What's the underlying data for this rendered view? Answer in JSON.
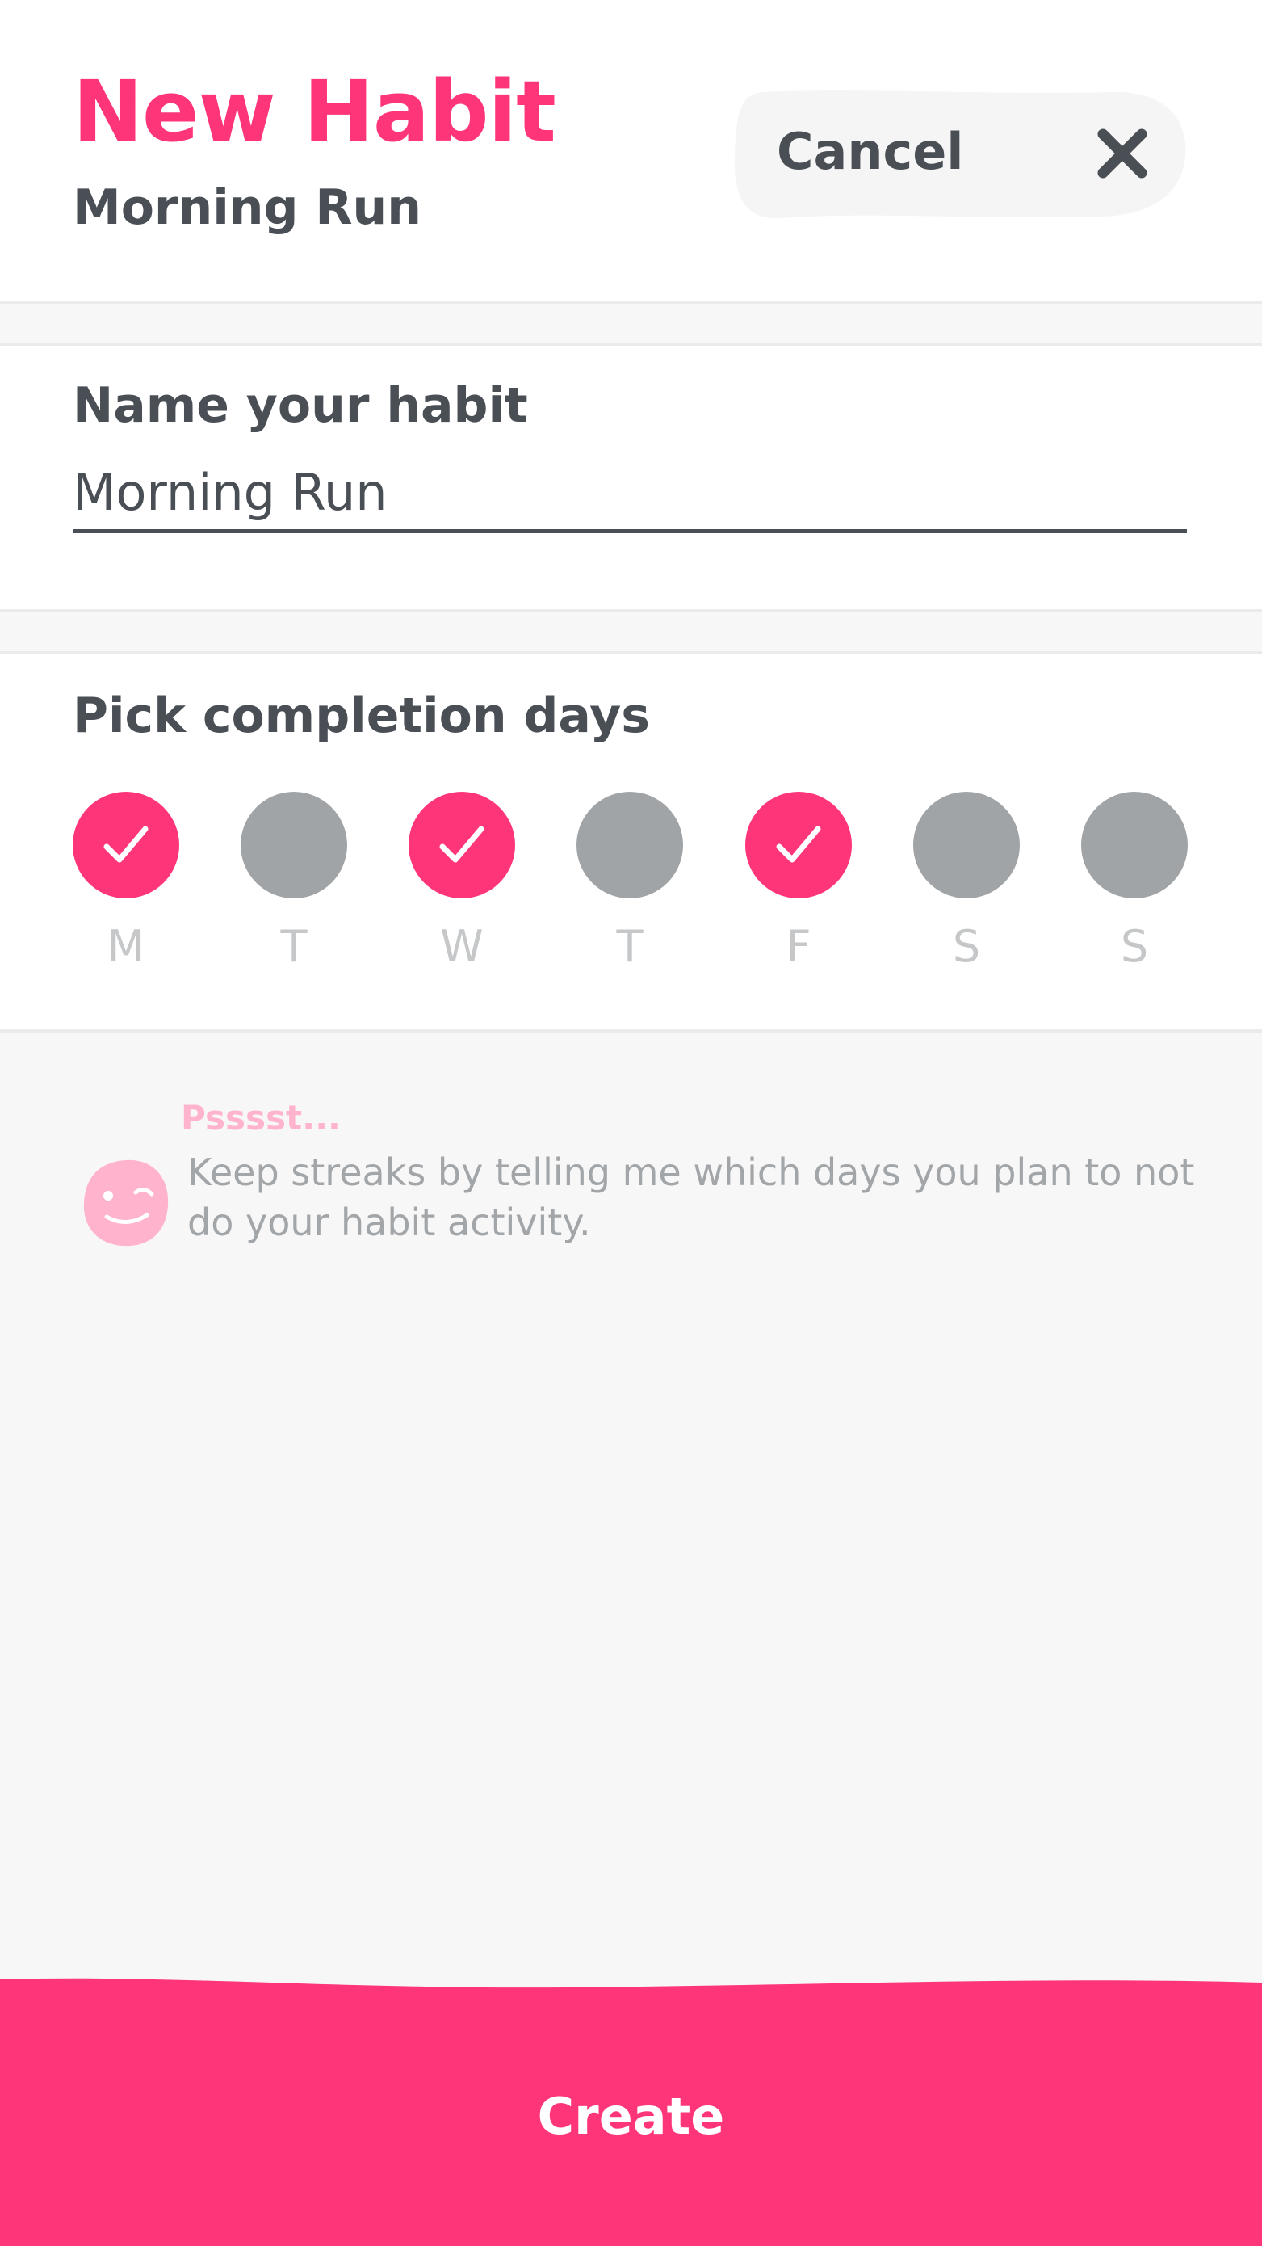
{
  "header": {
    "title": "New Habit",
    "subtitle": "Morning Run",
    "cancel_label": "Cancel",
    "cancel_icon": "close-icon"
  },
  "name_section": {
    "label": "Name your habit",
    "input_value": "Morning Run"
  },
  "days_section": {
    "label": "Pick completion days",
    "days": [
      {
        "letter": "M",
        "selected": true
      },
      {
        "letter": "T",
        "selected": false
      },
      {
        "letter": "W",
        "selected": true
      },
      {
        "letter": "T",
        "selected": false
      },
      {
        "letter": "F",
        "selected": true
      },
      {
        "letter": "S",
        "selected": false
      },
      {
        "letter": "S",
        "selected": false
      }
    ]
  },
  "tip": {
    "title": "Psssst...",
    "text": "Keep streaks by telling me which days you plan to not do your habit activity.",
    "icon": "winking-face-icon"
  },
  "footer": {
    "create_label": "Create"
  },
  "colors": {
    "accent": "#ff3579",
    "text_dark": "#4a4f56",
    "day_off": "#a1a4a6",
    "background": "#f7f7f7",
    "tip_pink": "#ffb3cd"
  }
}
